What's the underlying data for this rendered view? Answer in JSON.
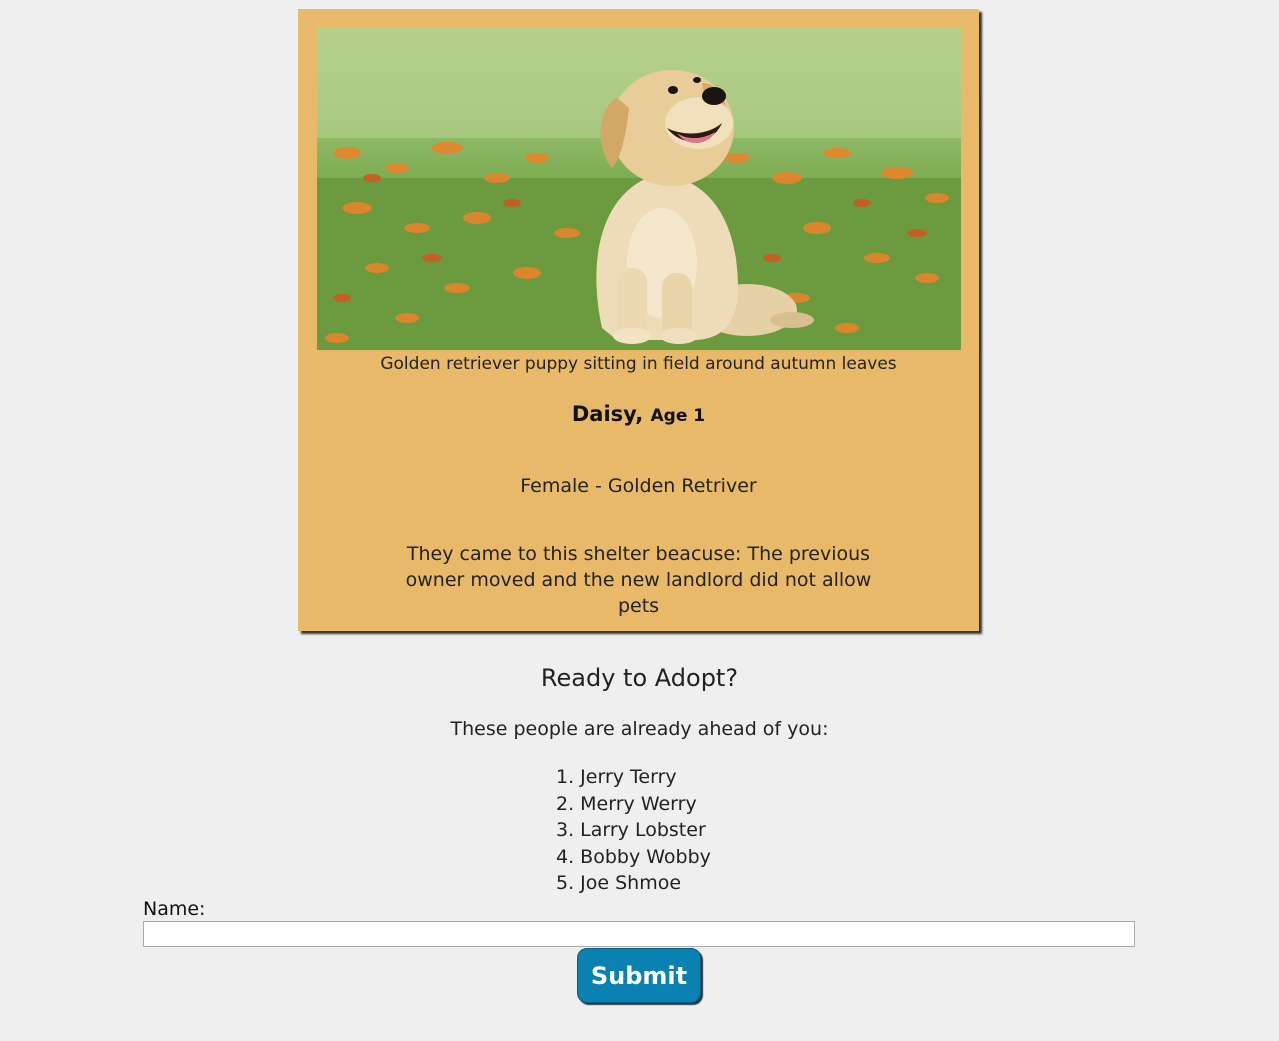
{
  "pet": {
    "image_caption": "Golden retriever puppy sitting in field around autumn leaves",
    "name": "Daisy,",
    "age": "Age 1",
    "info": "Female - Golden Retriver",
    "reason": "They came to this shelter beacuse: The previous owner moved and the new landlord did not allow pets"
  },
  "adopt": {
    "heading": "Ready to Adopt?",
    "queue_intro": "These people are already ahead of you:",
    "queue": [
      "1. Jerry Terry",
      "2. Merry Werry",
      "3. Larry Lobster",
      "4. Bobby Wobby",
      "5. Joe Shmoe"
    ]
  },
  "form": {
    "name_label": "Name:",
    "name_value": "",
    "submit_label": "Submit"
  },
  "colors": {
    "page_background": "#efefef",
    "card_background": "#e9b96a",
    "submit_button": "#0a81b0"
  }
}
